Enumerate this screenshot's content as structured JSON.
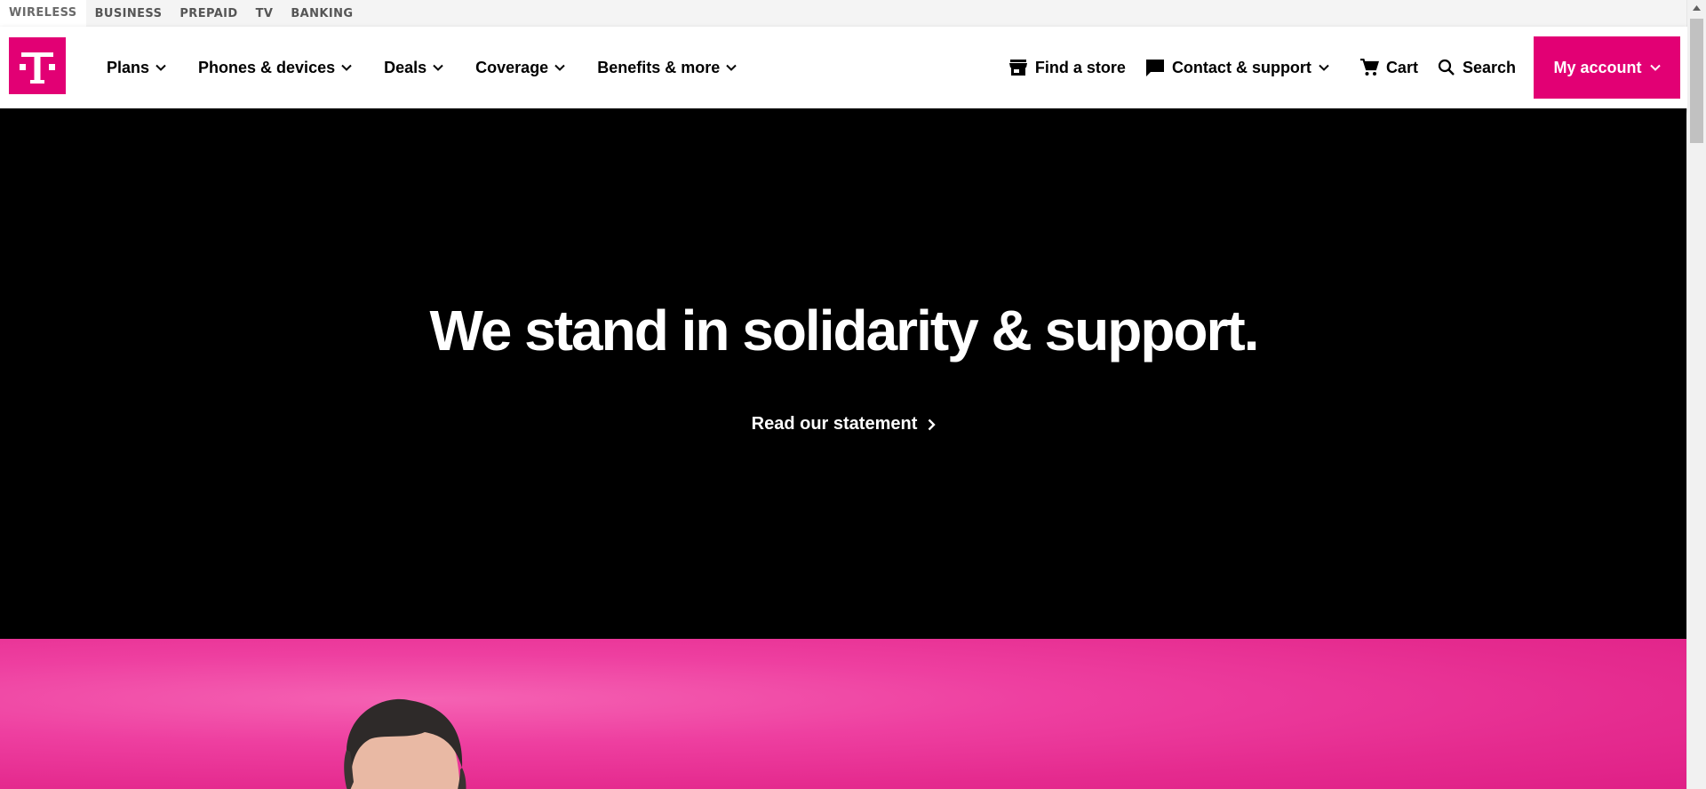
{
  "utility_nav": {
    "items": [
      {
        "label": "WIRELESS"
      },
      {
        "label": "BUSINESS"
      },
      {
        "label": "PREPAID"
      },
      {
        "label": "TV"
      },
      {
        "label": "BANKING"
      }
    ]
  },
  "header": {
    "logo_icon": "t-logo-icon",
    "brand_color": "#e20074",
    "nav": [
      {
        "label": "Plans"
      },
      {
        "label": "Phones & devices"
      },
      {
        "label": "Deals"
      },
      {
        "label": "Coverage"
      },
      {
        "label": "Benefits & more"
      }
    ],
    "utility": {
      "find_store": "Find a store",
      "contact": "Contact & support",
      "cart": "Cart",
      "search": "Search",
      "account": "My account"
    }
  },
  "hero": {
    "title": "We stand in solidarity & support.",
    "cta": "Read our statement",
    "background": "#000000"
  },
  "promo": {
    "background": "#e52b8f"
  }
}
